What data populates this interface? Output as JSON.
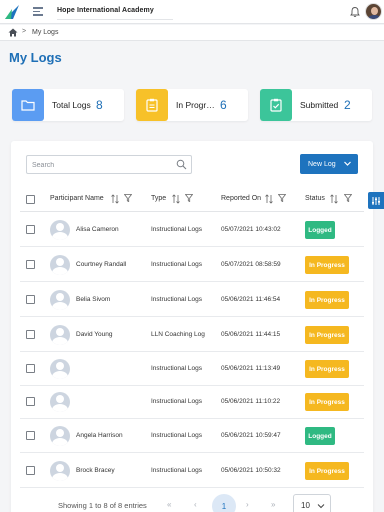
{
  "app": {
    "title": "Hope International Academy"
  },
  "breadcrumb": {
    "current": "My Logs",
    "separator": ">"
  },
  "page_title": "My Logs",
  "cards": [
    {
      "label": "Total Logs",
      "value": "8",
      "color": "#5b9cf2",
      "icon": "folder-icon"
    },
    {
      "label": "In Progress",
      "value": "6",
      "color": "#f7c129",
      "icon": "clipboard-icon"
    },
    {
      "label": "Submitted",
      "value": "2",
      "color": "#3cc59a",
      "icon": "clipboard-check-icon"
    }
  ],
  "search": {
    "placeholder": "Search",
    "value": ""
  },
  "new_log_label": "New Log",
  "columns": [
    "Participant Name",
    "Type",
    "Reported On",
    "Status"
  ],
  "rows": [
    {
      "name": "Alisa Cameron",
      "type": "Instructional Logs",
      "date": "05/07/2021 10:43:02",
      "status": "Logged"
    },
    {
      "name": "Courtney Randall",
      "type": "Instructional Logs",
      "date": "05/07/2021 08:58:59",
      "status": "In Progress"
    },
    {
      "name": "Belia Sivom",
      "type": "Instructional Logs",
      "date": "05/06/2021 11:46:54",
      "status": "In Progress"
    },
    {
      "name": "David Young",
      "type": "LLN Coaching Log",
      "date": "05/06/2021 11:44:15",
      "status": "In Progress"
    },
    {
      "name": "",
      "type": "Instructional Logs",
      "date": "05/06/2021 11:13:49",
      "status": "In Progress"
    },
    {
      "name": "",
      "type": "Instructional Logs",
      "date": "05/06/2021 11:10:22",
      "status": "In Progress"
    },
    {
      "name": "Angela Harrison",
      "type": "Instructional Logs",
      "date": "05/06/2021 10:59:47",
      "status": "Logged"
    },
    {
      "name": "Brock Bracey",
      "type": "Instructional Logs",
      "date": "05/06/2021 10:50:32",
      "status": "In Progress"
    }
  ],
  "pagination": {
    "summary": "Showing 1 to 8 of 8 entries",
    "first": "«",
    "prev": "‹",
    "current": "1",
    "next": "›",
    "last": "»",
    "page_size": "10"
  },
  "colors": {
    "accent": "#1e73be",
    "logged": "#2fb982",
    "in_progress": "#f5b820"
  }
}
